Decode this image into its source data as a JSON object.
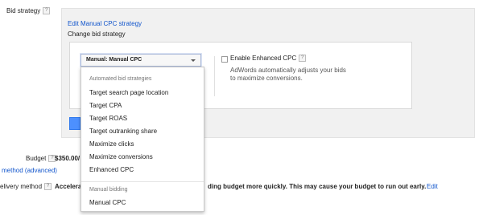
{
  "bid_strategy": {
    "label": "Bid strategy",
    "help": "?"
  },
  "panel": {
    "edit_link": "Edit Manual CPC strategy",
    "change_label": "Change bid strategy"
  },
  "select": {
    "value": "Manual: Manual CPC"
  },
  "dropdown": {
    "automated_header": "Automated bid strategies",
    "automated_items": [
      "Target search page location",
      "Target CPA",
      "Target ROAS",
      "Target outranking share",
      "Maximize clicks",
      "Maximize conversions",
      "Enhanced CPC"
    ],
    "manual_header": "Manual bidding",
    "manual_items": [
      "Manual CPC"
    ]
  },
  "enhanced_cpc": {
    "label": "Enable Enhanced CPC",
    "help": "?",
    "description_line1": "AdWords automatically adjusts your bids",
    "description_line2": "to maximize conversions."
  },
  "budget": {
    "label": "Budget",
    "help": "?",
    "value": "$350.00/"
  },
  "delivery": {
    "method_link": "method (advanced)",
    "label": "elivery method",
    "help": "?",
    "accel": "Accelera",
    "rest": "ding budget more quickly. This may cause your budget to run out early.",
    "edit": "Edit"
  },
  "colors": {
    "link": "#1155cc",
    "button": "#4d90fe",
    "panel_bg": "#f1f1f1"
  }
}
